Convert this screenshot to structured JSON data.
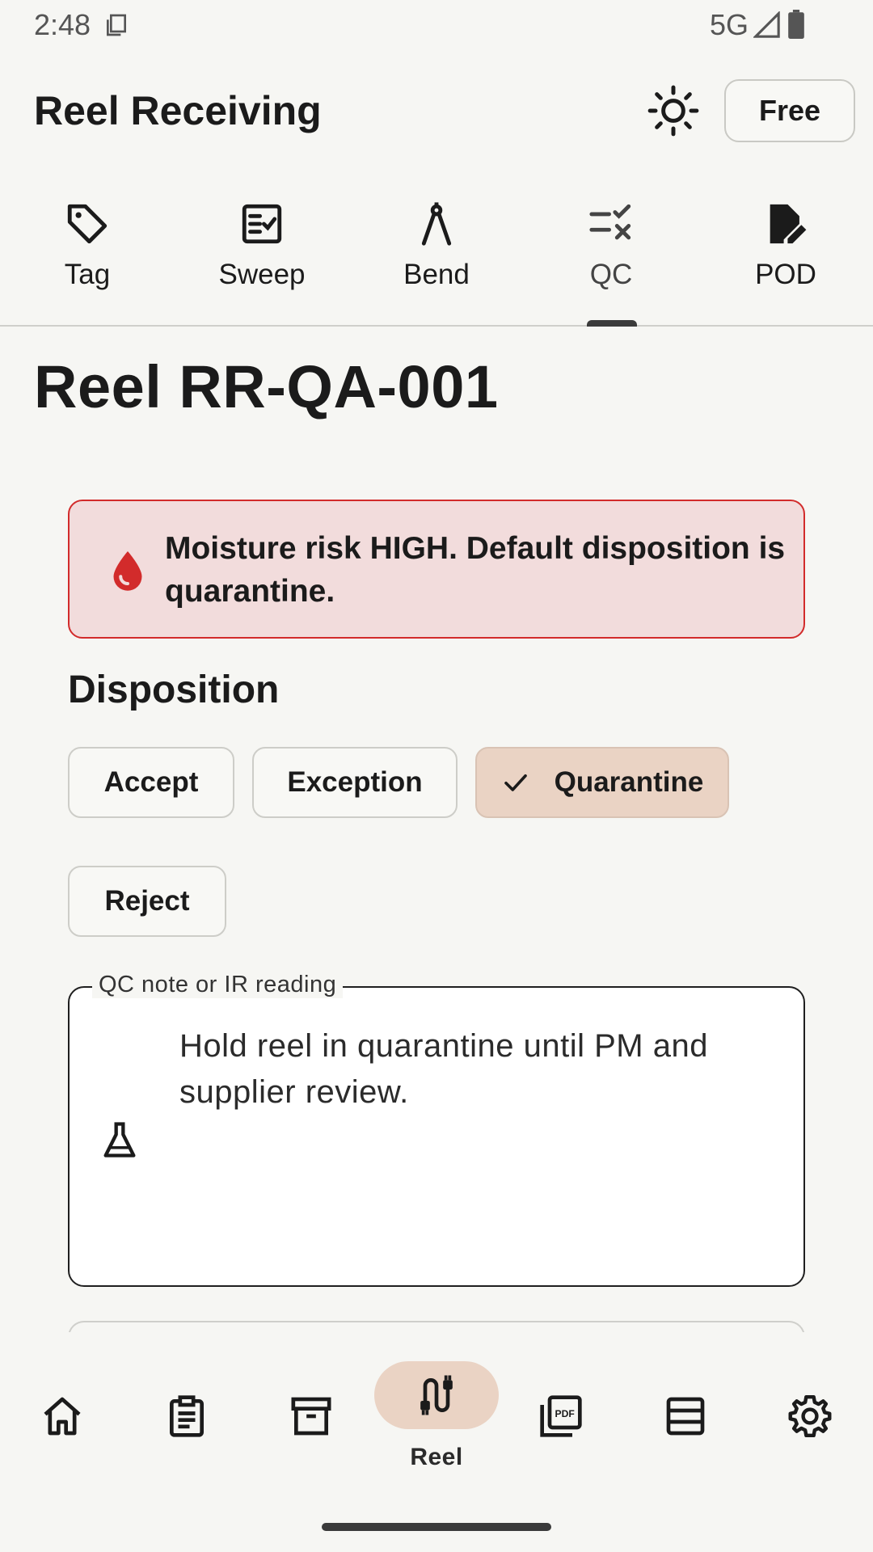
{
  "status_bar": {
    "time": "2:48",
    "network": "5G"
  },
  "app_bar": {
    "title": "Reel Receiving",
    "free_label": "Free",
    "theme_icon": "sun-icon"
  },
  "tabs": [
    {
      "label": "Tag",
      "icon": "tag-icon"
    },
    {
      "label": "Sweep",
      "icon": "checklist-icon"
    },
    {
      "label": "Bend",
      "icon": "compass-icon"
    },
    {
      "label": "QC",
      "icon": "qc-list-icon",
      "active": true
    },
    {
      "label": "POD",
      "icon": "signed-document-icon"
    }
  ],
  "page": {
    "title": "Reel RR-QA-001",
    "alert": {
      "text": "Moisture risk HIGH. Default disposition is quarantine.",
      "icon": "water-drop-icon",
      "color": "#d22b2b"
    },
    "disposition": {
      "title": "Disposition",
      "options": [
        "Accept",
        "Exception",
        "Quarantine",
        "Reject"
      ],
      "selected": "Quarantine"
    },
    "qc_field": {
      "label": "QC note or IR reading",
      "value": "Hold reel in quarantine until PM and supplier review.",
      "icon": "flask-icon"
    }
  },
  "bottom_nav": {
    "items": [
      {
        "icon": "home-icon"
      },
      {
        "icon": "clipboard-icon"
      },
      {
        "icon": "archive-icon"
      },
      {
        "icon": "cable-icon",
        "label": "Reel",
        "active": true
      },
      {
        "icon": "pdf-icon"
      },
      {
        "icon": "list-icon"
      },
      {
        "icon": "settings-gear-icon"
      }
    ]
  },
  "colors": {
    "background": "#f6f6f3",
    "accent_selected": "#ead3c4",
    "alert_bg": "#f2dcdc",
    "alert_border": "#d22b2b"
  }
}
